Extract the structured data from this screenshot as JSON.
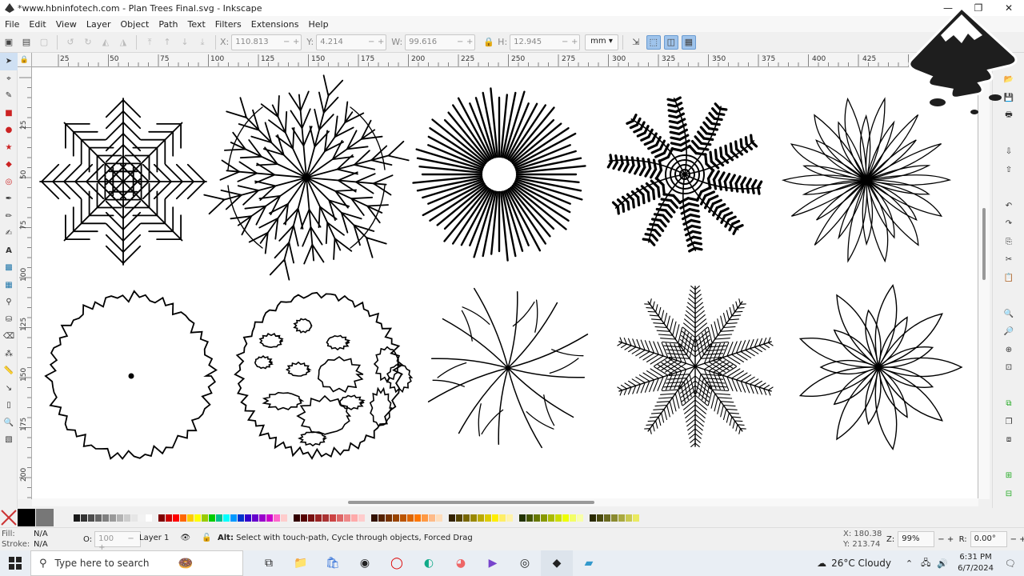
{
  "window": {
    "title": "*www.hbninfotech.com - Plan Trees Final.svg - Inkscape",
    "controls": [
      "—",
      "❐",
      "✕"
    ]
  },
  "menu": [
    "File",
    "Edit",
    "View",
    "Layer",
    "Object",
    "Path",
    "Text",
    "Filters",
    "Extensions",
    "Help"
  ],
  "toolbar": {
    "x_label": "X:",
    "x_value": "110.813",
    "y_label": "Y:",
    "y_value": "4.214",
    "w_label": "W:",
    "w_value": "99.616",
    "h_label": "H:",
    "h_value": "12.945",
    "unit": "mm"
  },
  "ruler_top": [
    "25",
    "50",
    "75",
    "100",
    "125",
    "150",
    "175",
    "200",
    "225",
    "250",
    "275",
    "300",
    "325",
    "350",
    "375",
    "400",
    "425"
  ],
  "ruler_left": [
    "25",
    "50",
    "75",
    "100",
    "125",
    "150",
    "175",
    "200"
  ],
  "status": {
    "fill_label": "Fill:",
    "fill_value": "N/A",
    "stroke_label": "Stroke:",
    "stroke_value": "N/A",
    "opacity_label": "O:",
    "opacity_value": "100",
    "layer": "Layer 1",
    "hint_key": "Alt:",
    "hint_text": "Select with touch-path, Cycle through objects, Forced Drag",
    "x_label": "X:",
    "x": "180.38",
    "y_label": "Y:",
    "y": "213.74",
    "zoom_label": "Z:",
    "zoom": "99%",
    "rot_label": "R:",
    "rotation": "0.00°"
  },
  "taskbar": {
    "search_placeholder": "Type here to search",
    "weather": "26°C  Cloudy",
    "time": "6:31 PM",
    "date": "6/7/2024"
  },
  "colors": {
    "accent": "#9fc4ec",
    "canvas": "#ffffff",
    "chrome": "#f0f0f0"
  }
}
